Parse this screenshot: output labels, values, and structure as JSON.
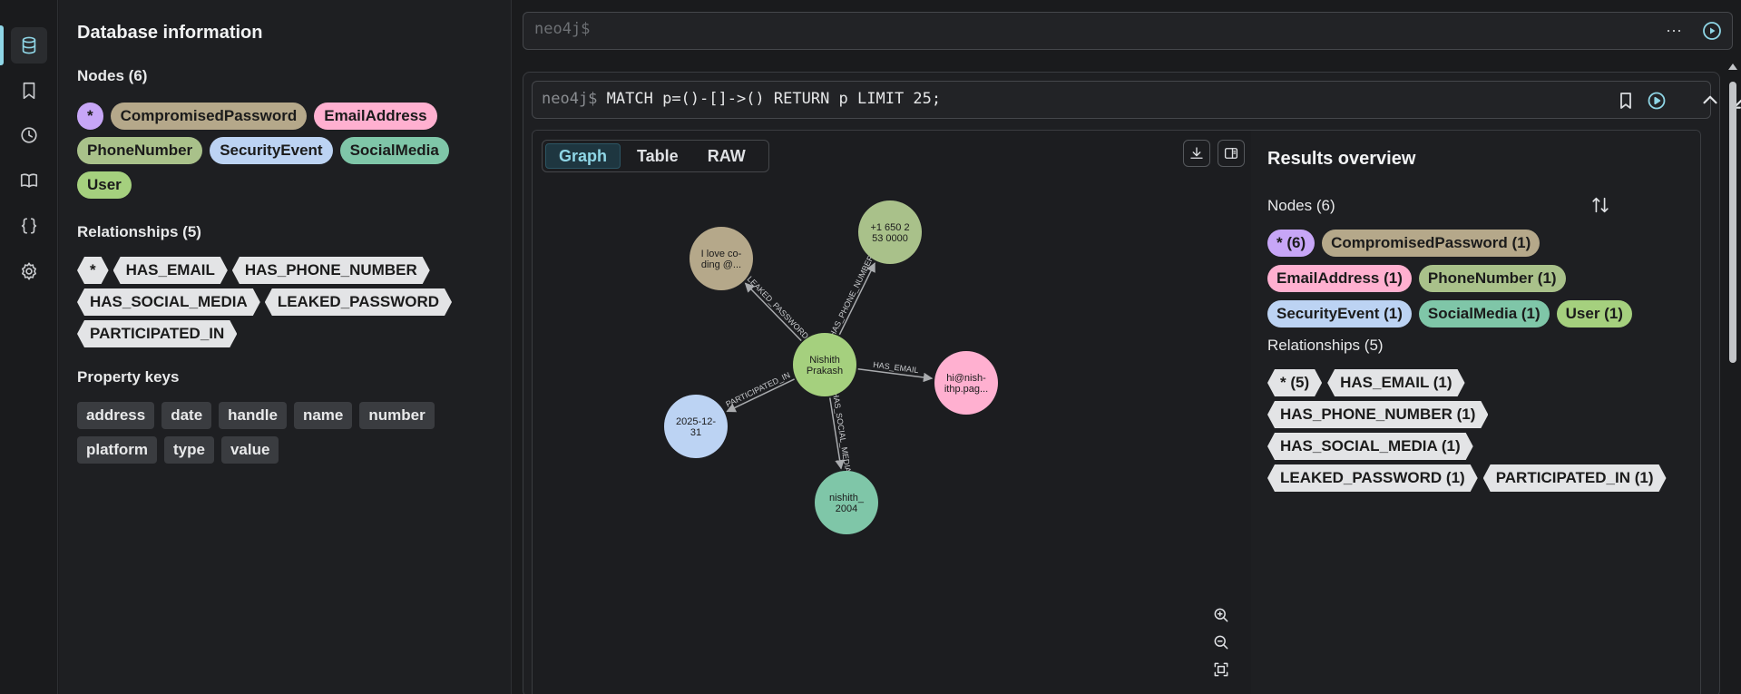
{
  "colors": {
    "accent": "#8fd6e6",
    "all": "#c7a6f7",
    "CompromisedPassword": "#b5a88a",
    "EmailAddress": "#ffb0d0",
    "PhoneNumber": "#a9c18a",
    "SecurityEvent": "#bcd3f3",
    "SocialMedia": "#7fc6a8",
    "User": "#a5d07e",
    "relationship": "#e3e4e6"
  },
  "rail": {
    "items": [
      "database-icon",
      "bookmark-icon",
      "history-icon",
      "book-icon",
      "braces-icon",
      "gear-icon"
    ]
  },
  "db_info": {
    "title": "Database information",
    "nodes_label": "Nodes (6)",
    "nodes": [
      {
        "label": "*",
        "color": "#c7a6f7"
      },
      {
        "label": "CompromisedPassword",
        "color": "#b5a88a"
      },
      {
        "label": "EmailAddress",
        "color": "#ffb0d0"
      },
      {
        "label": "PhoneNumber",
        "color": "#a9c18a"
      },
      {
        "label": "SecurityEvent",
        "color": "#bcd3f3"
      },
      {
        "label": "SocialMedia",
        "color": "#7fc6a8"
      },
      {
        "label": "User",
        "color": "#a5d07e"
      }
    ],
    "relationships_label": "Relationships (5)",
    "relationships": [
      "*",
      "HAS_EMAIL",
      "HAS_PHONE_NUMBER",
      "HAS_SOCIAL_MEDIA",
      "LEAKED_PASSWORD",
      "PARTICIPATED_IN"
    ],
    "property_keys_label": "Property keys",
    "property_keys": [
      "address",
      "date",
      "handle",
      "name",
      "number",
      "platform",
      "type",
      "value"
    ]
  },
  "editor": {
    "placeholder": "neo4j$",
    "more": "···"
  },
  "frame": {
    "prompt": "neo4j$",
    "query": "MATCH p=()-[]->() RETURN p LIMIT 25;"
  },
  "tabs": [
    {
      "label": "Graph",
      "active": true
    },
    {
      "label": "Table",
      "active": false
    },
    {
      "label": "RAW",
      "active": false
    }
  ],
  "graph": {
    "nodes": [
      {
        "id": "user",
        "lines": [
          "Nishith",
          "Prakash"
        ],
        "color": "#a5d07e"
      },
      {
        "id": "pwd",
        "lines": [
          "I love co-",
          "ding @..."
        ],
        "color": "#b5a88a"
      },
      {
        "id": "phone",
        "lines": [
          "+1 650 2",
          "53 0000"
        ],
        "color": "#a9c18a"
      },
      {
        "id": "email",
        "lines": [
          "hi@nish-",
          "ithp.pag..."
        ],
        "color": "#ffb0d0"
      },
      {
        "id": "social",
        "lines": [
          "nishith_",
          "2004"
        ],
        "color": "#7fc6a8"
      },
      {
        "id": "event",
        "lines": [
          "2025-12-",
          "31"
        ],
        "color": "#bcd3f3"
      }
    ],
    "edges": [
      {
        "from": "user",
        "to": "pwd",
        "label": "LEAKED_PASSWORD"
      },
      {
        "from": "user",
        "to": "phone",
        "label": "HAS_PHONE_NUMBER"
      },
      {
        "from": "user",
        "to": "email",
        "label": "HAS_EMAIL"
      },
      {
        "from": "user",
        "to": "social",
        "label": "HAS_SOCIAL_MEDIA"
      },
      {
        "from": "user",
        "to": "event",
        "label": "PARTICIPATED_IN"
      }
    ]
  },
  "overview": {
    "title": "Results overview",
    "nodes_label": "Nodes (6)",
    "nodes": [
      {
        "label": "* (6)",
        "color": "#c7a6f7"
      },
      {
        "label": "CompromisedPassword (1)",
        "color": "#b5a88a"
      },
      {
        "label": "EmailAddress (1)",
        "color": "#ffb0d0"
      },
      {
        "label": "PhoneNumber (1)",
        "color": "#a9c18a"
      },
      {
        "label": "SecurityEvent (1)",
        "color": "#bcd3f3"
      },
      {
        "label": "SocialMedia (1)",
        "color": "#7fc6a8"
      },
      {
        "label": "User (1)",
        "color": "#a5d07e"
      }
    ],
    "relationships_label": "Relationships (5)",
    "relationships": [
      "* (5)",
      "HAS_EMAIL (1)",
      "HAS_PHONE_NUMBER (1)",
      "HAS_SOCIAL_MEDIA (1)",
      "LEAKED_PASSWORD (1)",
      "PARTICIPATED_IN (1)"
    ]
  }
}
